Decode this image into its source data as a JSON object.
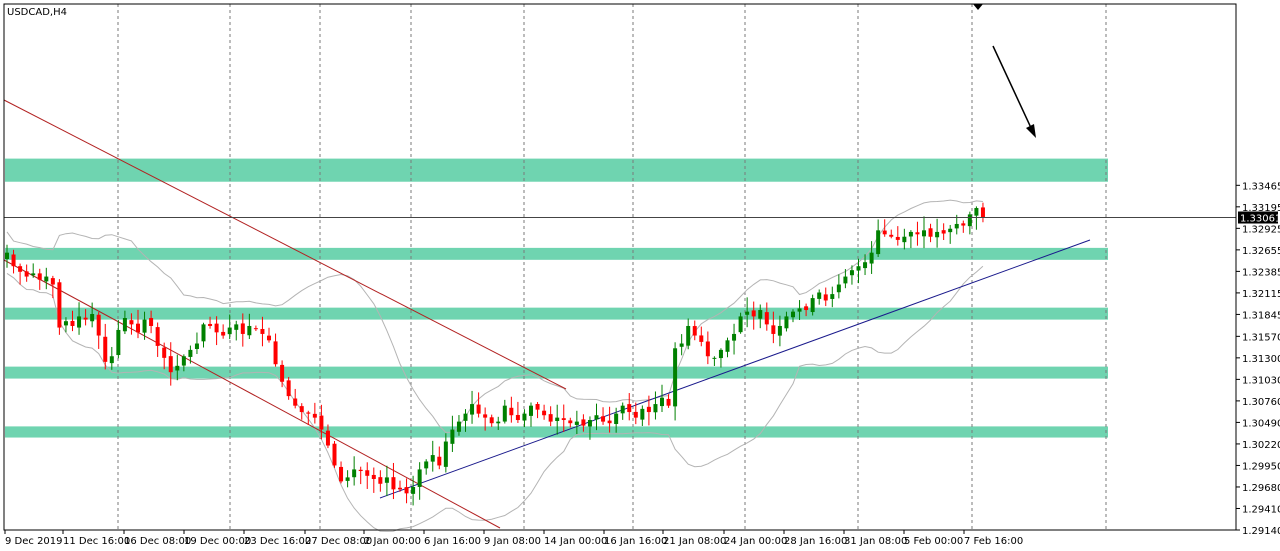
{
  "chart_data": {
    "type": "candlestick",
    "title": "USDCAD,H4",
    "symbol": "USDCAD",
    "timeframe": "H4",
    "ylim": [
      1.2914,
      1.3574
    ],
    "y_ticks": [
      "1.33465",
      "1.33195",
      "1.32925",
      "1.32655",
      "1.32385",
      "1.32115",
      "1.31845",
      "1.31570",
      "1.31300",
      "1.31030",
      "1.30760",
      "1.30490",
      "1.30220",
      "1.29950",
      "1.29680",
      "1.29410",
      "1.29140"
    ],
    "x_ticks": [
      "9 Dec 2019",
      "11 Dec 16:00",
      "16 Dec 08:00",
      "19 Dec 00:00",
      "23 Dec 16:00",
      "27 Dec 08:00",
      "2 Jan 00:00",
      "6 Jan 16:00",
      "9 Jan 08:00",
      "14 Jan 00:00",
      "16 Jan 16:00",
      "21 Jan 08:00",
      "24 Jan 00:00",
      "28 Jan 16:00",
      "31 Jan 08:00",
      "5 Feb 00:00",
      "7 Feb 16:00"
    ],
    "current_price": "1.33061",
    "current_price_value": 1.33061,
    "close_path": [
      1.3262,
      1.3245,
      1.3238,
      1.3232,
      1.3236,
      1.3228,
      1.3232,
      1.3222,
      1.3168,
      1.3176,
      1.317,
      1.3182,
      1.3178,
      1.3185,
      1.3158,
      1.3125,
      1.3132,
      1.3165,
      1.318,
      1.3172,
      1.3162,
      1.3178,
      1.317,
      1.3145,
      1.313,
      1.3112,
      1.312,
      1.3132,
      1.314,
      1.3148,
      1.3172,
      1.317,
      1.3162,
      1.3158,
      1.3168,
      1.3172,
      1.316,
      1.317,
      1.3166,
      1.316,
      1.3152,
      1.3122,
      1.31,
      1.3082,
      1.307,
      1.3062,
      1.306,
      1.3055,
      1.304,
      1.302,
      1.2995,
      1.2975,
      1.298,
      1.299,
      1.2988,
      1.2982,
      1.2978,
      1.2972,
      1.298,
      1.2965,
      1.2965,
      1.296,
      1.2968,
      1.299,
      1.3,
      1.3008,
      1.2995,
      1.3025,
      1.304,
      1.305,
      1.306,
      1.3072,
      1.306,
      1.3055,
      1.3048,
      1.305,
      1.307,
      1.3058,
      1.3052,
      1.306,
      1.307,
      1.3065,
      1.3058,
      1.305,
      1.3055,
      1.3052,
      1.3048,
      1.305,
      1.3045,
      1.3052,
      1.3058,
      1.305,
      1.3048,
      1.306,
      1.307,
      1.3062,
      1.3055,
      1.3066,
      1.3062,
      1.3072,
      1.308,
      1.307,
      1.3142,
      1.3148,
      1.317,
      1.3158,
      1.315,
      1.3132,
      1.313,
      1.314,
      1.3152,
      1.316,
      1.3182,
      1.3188,
      1.3182,
      1.319,
      1.3172,
      1.316,
      1.317,
      1.3182,
      1.3188,
      1.3192,
      1.319,
      1.3205,
      1.3212,
      1.3202,
      1.321,
      1.3222,
      1.3232,
      1.324,
      1.3245,
      1.325,
      1.3262,
      1.329,
      1.3285,
      1.3282,
      1.3278,
      1.3282,
      1.3288,
      1.3285,
      1.329,
      1.3282,
      1.3288,
      1.3286,
      1.3292,
      1.3298,
      1.3296,
      1.331,
      1.3318,
      1.3306
    ],
    "series": [
      {
        "name": "Bollinger Bands"
      },
      {
        "name": "Descending channel"
      },
      {
        "name": "Ascending trendline"
      }
    ],
    "zones": [
      {
        "low": 1.3351,
        "high": 1.338
      },
      {
        "low": 1.3253,
        "high": 1.3268
      },
      {
        "low": 1.3178,
        "high": 1.3193
      },
      {
        "low": 1.3104,
        "high": 1.3119
      },
      {
        "low": 1.303,
        "high": 1.3044
      }
    ],
    "colors": {
      "up": "#008000",
      "down": "#ff0000",
      "zone": "#6fd4b0",
      "trendline": "#1a1a8c",
      "channel": "#b22222",
      "bands": "#b4b4b4",
      "grid": "#7a7a7a"
    },
    "grid": true
  }
}
